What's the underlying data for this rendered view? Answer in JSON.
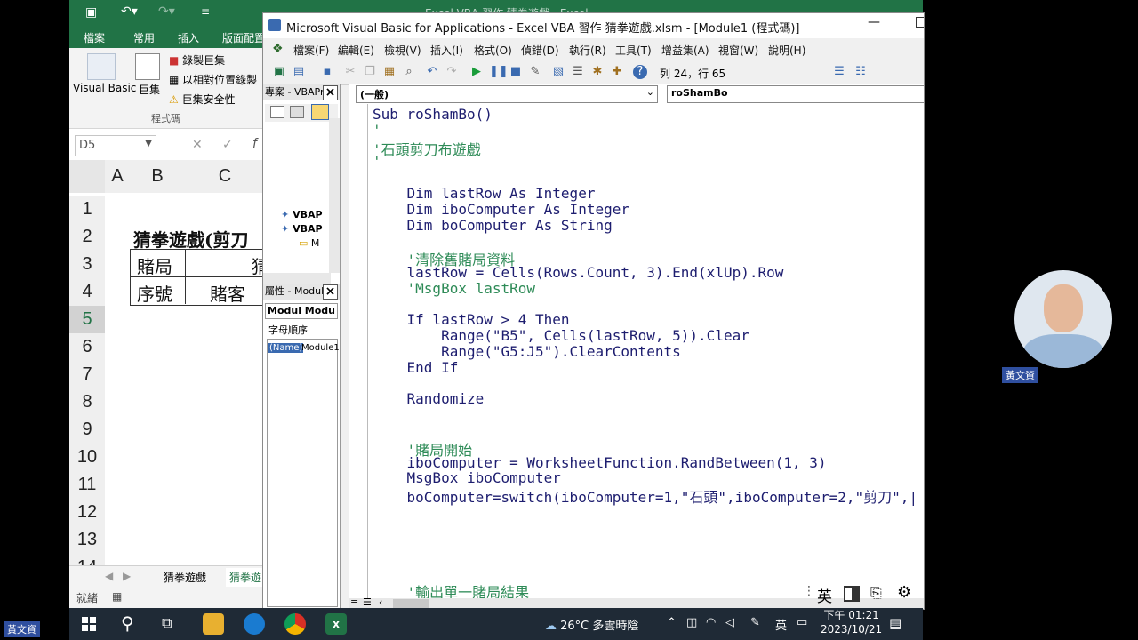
{
  "excel": {
    "title": "Excel VBA 習作 猜拳遊戲 - Excel",
    "tabs": [
      "檔案",
      "常用",
      "插入",
      "版面配置"
    ],
    "ribbon": {
      "visual_basic": "Visual Basic",
      "macros": "巨集",
      "record_macro": "錄製巨集",
      "relative_ref": "以相對位置錄製",
      "macro_security": "巨集安全性",
      "group_label": "程式碼"
    },
    "name_box": "D5",
    "columns": [
      "A",
      "B",
      "C"
    ],
    "rows": [
      "1",
      "2",
      "3",
      "4",
      "5",
      "6",
      "7",
      "8",
      "9",
      "10",
      "11",
      "12",
      "13",
      "14"
    ],
    "cells": {
      "b2": "猜拳遊戲(剪刀",
      "b3": "賭局",
      "b4": "序號",
      "c4": "賭客",
      "c3": "猜"
    },
    "sheet_tabs": [
      "猜拳遊戲",
      "猜拳遊"
    ],
    "status": "就緒"
  },
  "vbe": {
    "title": "Microsoft Visual Basic for Applications - Excel VBA 習作 猜拳遊戲.xlsm - [Module1 (程式碼)]",
    "menu": [
      "檔案(F)",
      "編輯(E)",
      "檢視(V)",
      "插入(I)",
      "格式(O)",
      "偵錯(D)",
      "執行(R)",
      "工具(T)",
      "增益集(A)",
      "視窗(W)",
      "說明(H)"
    ],
    "cursor_pos": "列 24，行 65",
    "project_pane_title": "專案 - VBAPro",
    "project_items": [
      "VBAP",
      "VBAP",
      "M"
    ],
    "properties_pane_title": "屬性 - Module",
    "prop_combo": "Modul Modu",
    "prop_tab": "字母順序",
    "prop_name_key": "(Name)",
    "prop_name_val": "Module1",
    "combo_object": "(一般)",
    "combo_proc": "roShamBo",
    "code": [
      "Sub roShamBo()",
      "'",
      "'石頭剪刀布遊戲",
      "'",
      "",
      "    Dim lastRow As Integer",
      "    Dim iboComputer As Integer",
      "    Dim boComputer As String",
      "",
      "    '清除舊賭局資料",
      "    lastRow = Cells(Rows.Count, 3).End(xlUp).Row",
      "    'MsgBox lastRow",
      "",
      "    If lastRow > 4 Then",
      "        Range(\"B5\", Cells(lastRow, 5)).Clear",
      "        Range(\"G5:J5\").ClearContents",
      "    End If",
      "",
      "    Randomize",
      "",
      "",
      "    '賭局開始",
      "    iboComputer = WorksheetFunction.RandBetween(1, 3)",
      "    MsgBox iboComputer",
      "    boComputer=switch(iboComputer=1,\"石頭\",iboComputer=2,\"剪刀\",|",
      "",
      "",
      "",
      "",
      "",
      "    '輸出單一賭局結果"
    ]
  },
  "presenter": {
    "name": "黃文資"
  },
  "taskbar": {
    "weather": "26°C  多雲時陰",
    "ime": "英",
    "time": "下午 01:21",
    "date": "2023/10/21"
  },
  "ime_bar": {
    "mode": "英"
  },
  "colors": {
    "excel_green": "#217346",
    "code_keyword": "#1d1d6f",
    "code_comment": "#2e8b57",
    "taskbar": "#1f2a36"
  }
}
